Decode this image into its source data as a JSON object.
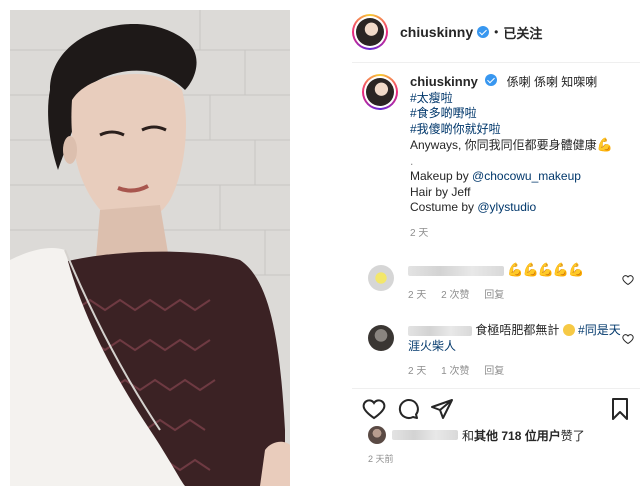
{
  "header": {
    "username": "chiuskinny",
    "follow_label": "已关注"
  },
  "caption": {
    "username": "chiuskinny",
    "line1_rest": "係喇 係喇 知㗎喇",
    "tags": [
      "#太瘦啦",
      "#食多啲嘢啦",
      "#我傻啲你就好啦"
    ],
    "anyways": "Anyways, 你同我同佢都要身體健康",
    "makeup_prefix": "Makeup by ",
    "makeup_tag": "@chocowu_makeup",
    "hair": "Hair by Jeff",
    "costume_prefix": "Costume by ",
    "costume_tag": "@ylystudio",
    "time": "2 天"
  },
  "comments": [
    {
      "text": "💪💪💪💪💪",
      "time": "2 天",
      "likes": "2 次赞",
      "reply": "回复"
    },
    {
      "text": "食極唔肥都無計",
      "tag": "#同是天涯火柴人",
      "time": "2 天",
      "likes": "1 次赞",
      "reply": "回复"
    }
  ],
  "likes": {
    "conj": "和 ",
    "others": "其他 718 位用户",
    "verb": " 赞了"
  },
  "posted": "2 天前",
  "colors": {
    "link": "#00376b",
    "meta": "#8e8e8e",
    "verified": "#3897f0"
  },
  "icons": [
    "heart-icon",
    "comment-icon",
    "share-icon",
    "bookmark-icon",
    "verified-badge-icon",
    "more-dots-icon"
  ]
}
